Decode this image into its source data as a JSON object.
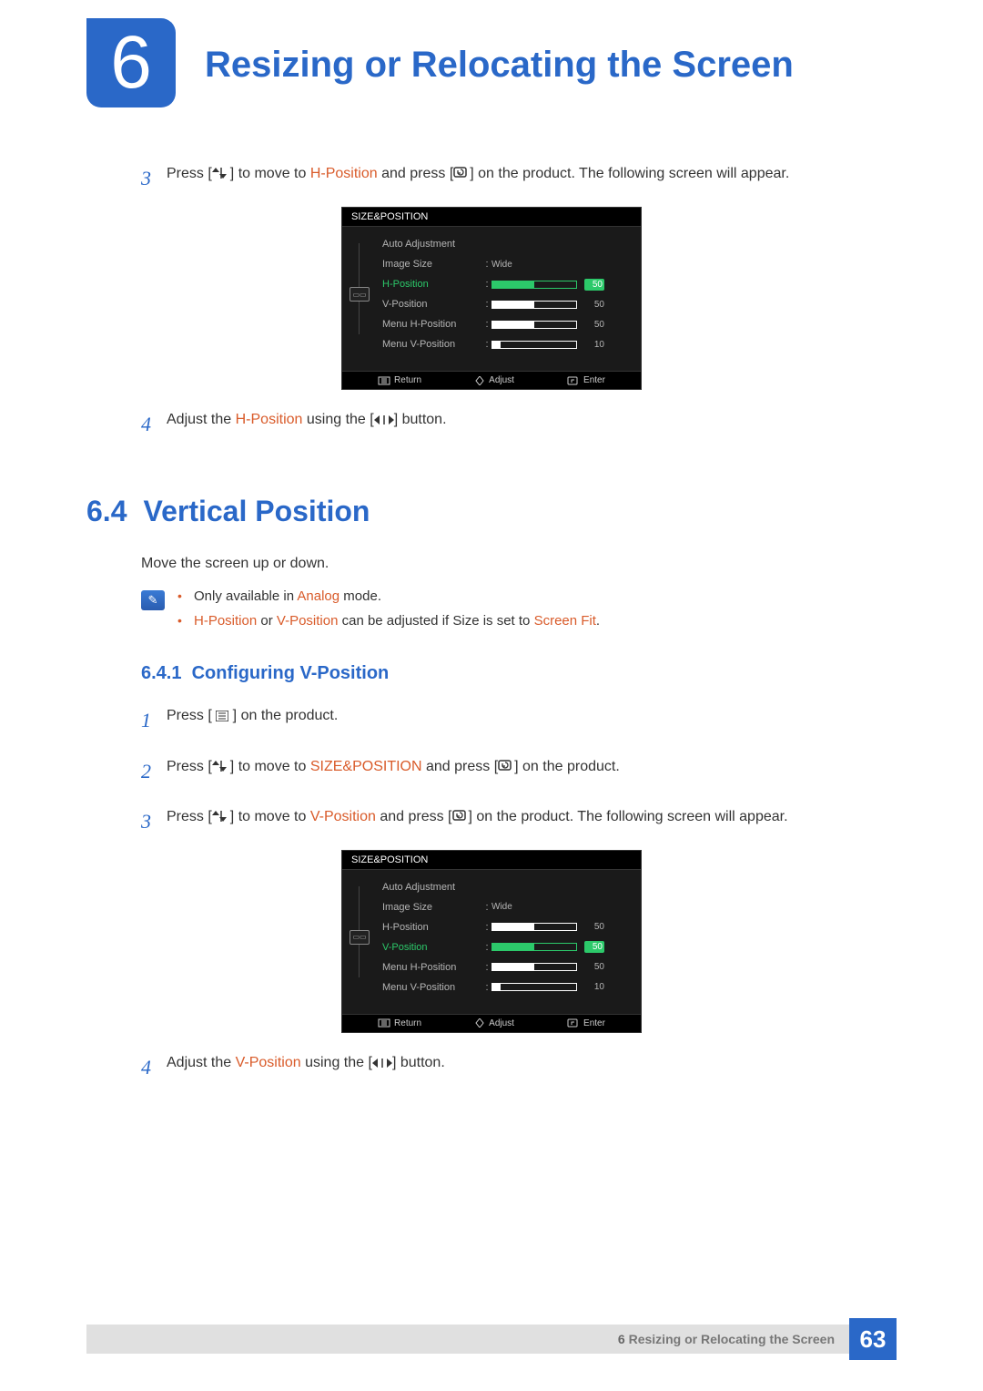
{
  "chapter": {
    "number": "6",
    "title": "Resizing or Relocating the Screen"
  },
  "steps_top": {
    "s3": {
      "num": "3",
      "t1": "Press [",
      "t2": "] to move to ",
      "hl1": "H-Position",
      "t3": " and press [",
      "t4": "] on the product. The following screen will appear."
    },
    "s4": {
      "num": "4",
      "t1": "Adjust the ",
      "hl1": "H-Position",
      "t2": " using the [",
      "t3": "] button."
    }
  },
  "osd1": {
    "title": "SIZE&POSITION",
    "rows": [
      {
        "label": "Auto Adjustment",
        "value": "",
        "bar": null,
        "val": "",
        "active": false
      },
      {
        "label": "Image Size",
        "value": "Wide",
        "bar": null,
        "val": "",
        "active": false
      },
      {
        "label": "H-Position",
        "value": "",
        "bar": 50,
        "val": "50",
        "active": true
      },
      {
        "label": "V-Position",
        "value": "",
        "bar": 50,
        "val": "50",
        "active": false
      },
      {
        "label": "Menu H-Position",
        "value": "",
        "bar": 50,
        "val": "50",
        "active": false
      },
      {
        "label": "Menu V-Position",
        "value": "",
        "bar": 10,
        "val": "10",
        "active": false
      }
    ],
    "footer": {
      "return": "Return",
      "adjust": "Adjust",
      "enter": "Enter"
    }
  },
  "section64": {
    "num": "6.4",
    "title": "Vertical Position"
  },
  "desc64": "Move the screen up or down.",
  "notes": {
    "n1": {
      "t1": "Only available in ",
      "hl1": "Analog",
      "t2": " mode."
    },
    "n2": {
      "hl1": "H-Position",
      "t1": " or ",
      "hl2": "V-Position",
      "t2": " can be adjusted if Size is set to ",
      "hl3": "Screen Fit",
      "t3": "."
    }
  },
  "sub641": {
    "num": "6.4.1",
    "title": "Configuring V-Position"
  },
  "steps_v": {
    "s1": {
      "num": "1",
      "t1": "Press [ ",
      "t2": " ] on the product."
    },
    "s2": {
      "num": "2",
      "t1": "Press [",
      "t2": "] to move to ",
      "hl1": "SIZE&POSITION",
      "t3": " and press [",
      "t4": "] on the product."
    },
    "s3": {
      "num": "3",
      "t1": "Press [",
      "t2": "] to move to ",
      "hl1": "V-Position",
      "t3": " and press [",
      "t4": "] on the product. The following screen will appear."
    },
    "s4": {
      "num": "4",
      "t1": "Adjust the ",
      "hl1": "V-Position",
      "t2": " using the [",
      "t3": "] button."
    }
  },
  "osd2": {
    "title": "SIZE&POSITION",
    "rows": [
      {
        "label": "Auto Adjustment",
        "value": "",
        "bar": null,
        "val": "",
        "active": false
      },
      {
        "label": "Image Size",
        "value": "Wide",
        "bar": null,
        "val": "",
        "active": false
      },
      {
        "label": "H-Position",
        "value": "",
        "bar": 50,
        "val": "50",
        "active": false
      },
      {
        "label": "V-Position",
        "value": "",
        "bar": 50,
        "val": "50",
        "active": true
      },
      {
        "label": "Menu H-Position",
        "value": "",
        "bar": 50,
        "val": "50",
        "active": false
      },
      {
        "label": "Menu V-Position",
        "value": "",
        "bar": 10,
        "val": "10",
        "active": false
      }
    ],
    "footer": {
      "return": "Return",
      "adjust": "Adjust",
      "enter": "Enter"
    }
  },
  "footer": {
    "chapter": "6",
    "title": "Resizing or Relocating the Screen",
    "page": "63"
  }
}
